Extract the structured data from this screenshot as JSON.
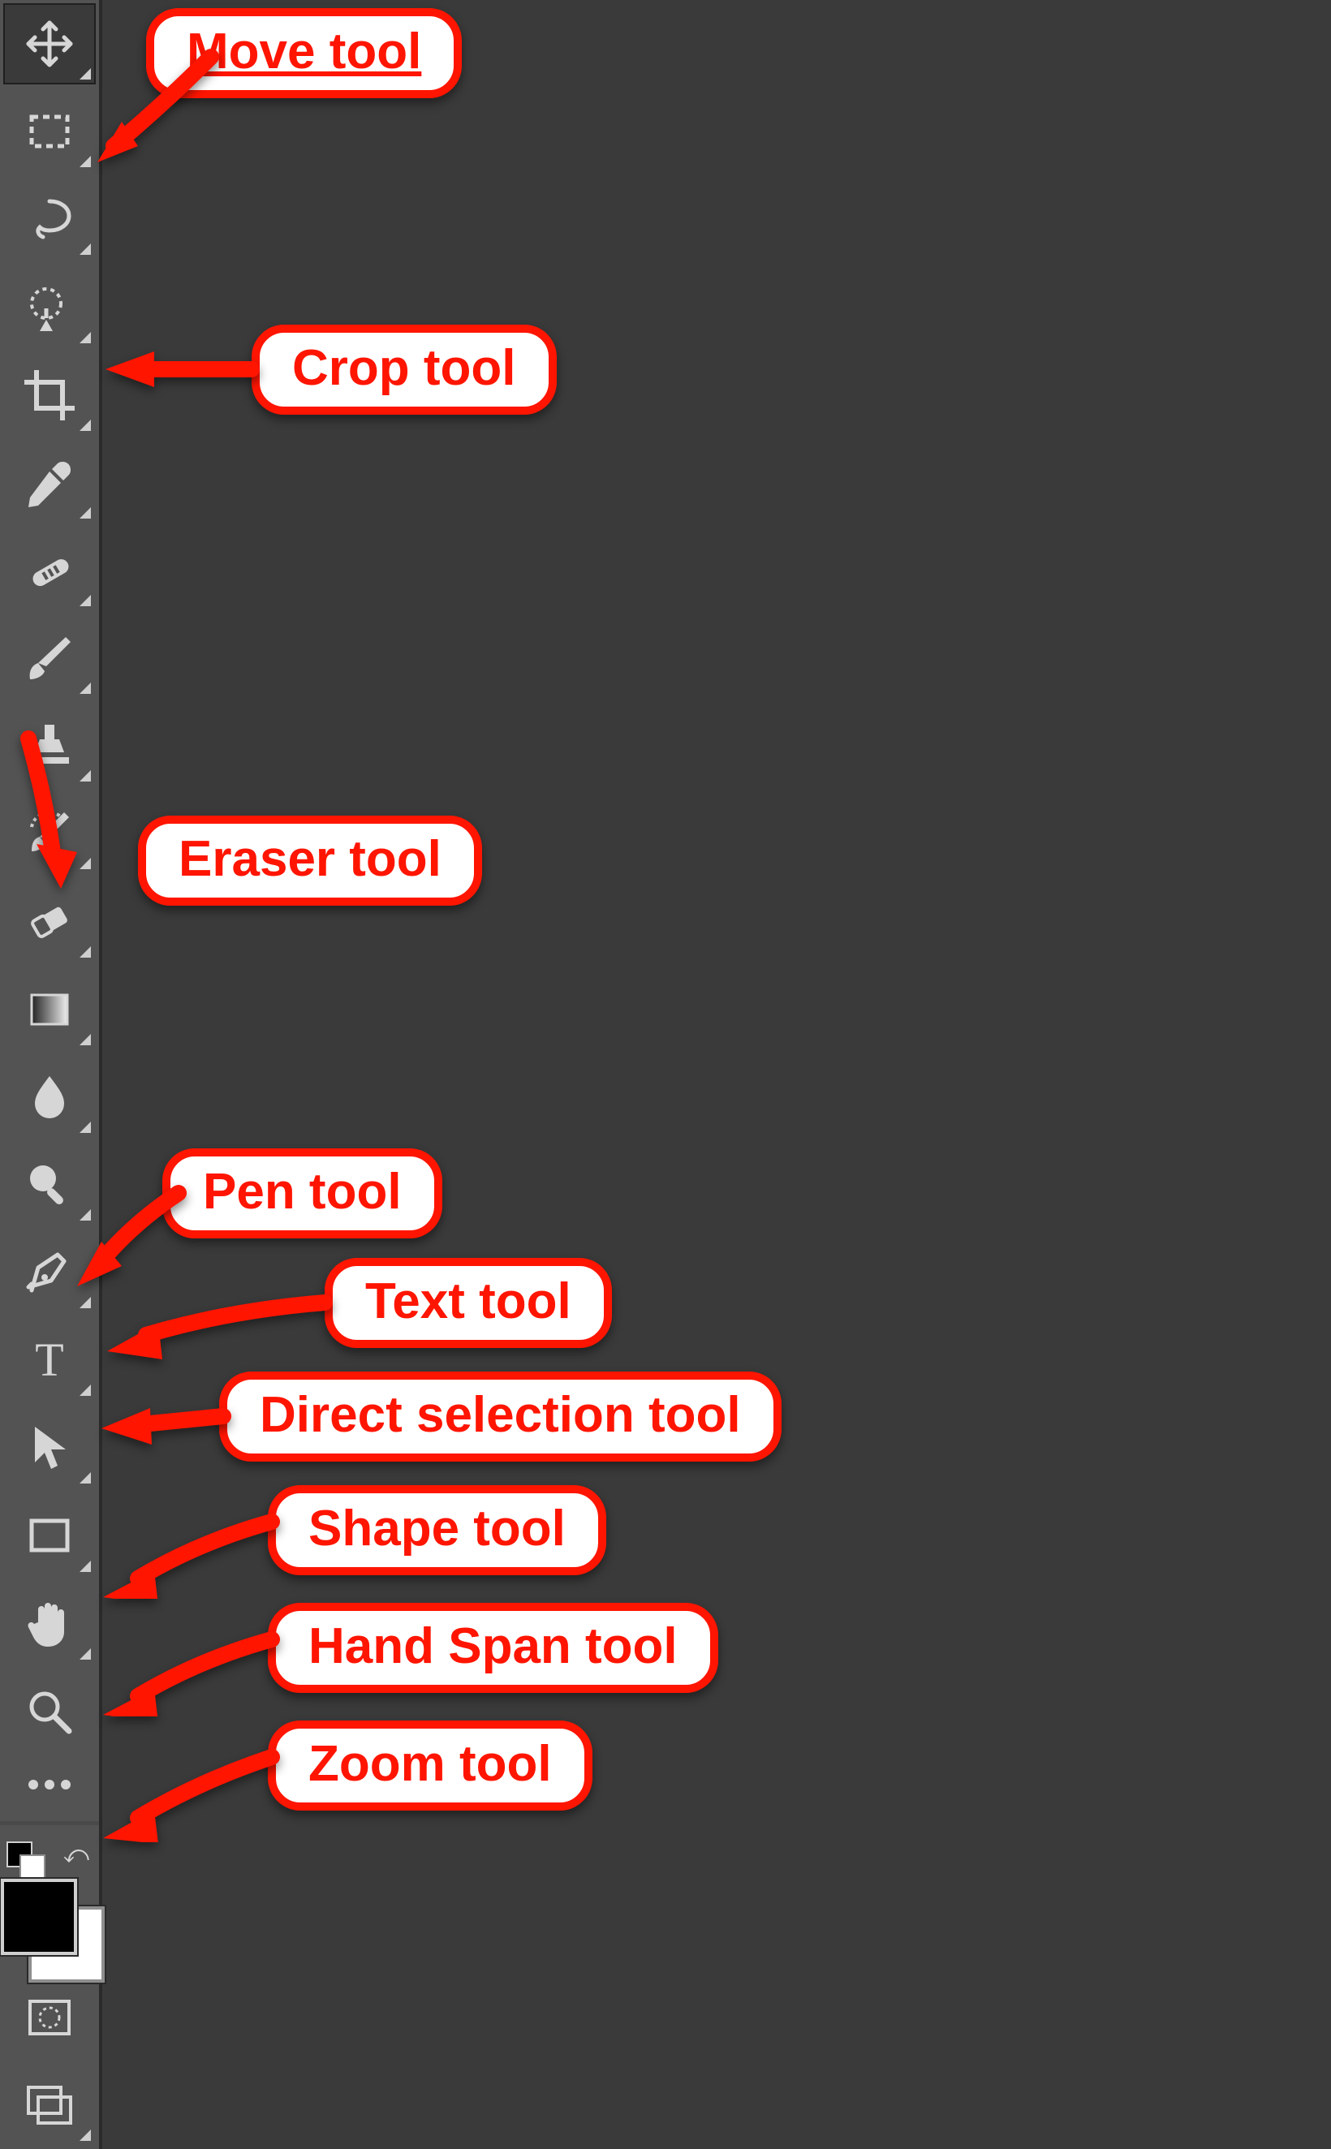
{
  "toolbar": {
    "tools": [
      {
        "id": "move",
        "name": "Move",
        "icon": "move-icon",
        "selected": true,
        "flyout": true
      },
      {
        "id": "marquee",
        "name": "Rectangular Marquee",
        "icon": "marquee-icon",
        "selected": false,
        "flyout": true
      },
      {
        "id": "lasso",
        "name": "Lasso",
        "icon": "lasso-icon",
        "selected": false,
        "flyout": true
      },
      {
        "id": "quick-select",
        "name": "Quick Selection",
        "icon": "quick-select-icon",
        "selected": false,
        "flyout": true
      },
      {
        "id": "crop",
        "name": "Crop",
        "icon": "crop-icon",
        "selected": false,
        "flyout": true
      },
      {
        "id": "eyedropper",
        "name": "Eyedropper",
        "icon": "eyedropper-icon",
        "selected": false,
        "flyout": true
      },
      {
        "id": "healing",
        "name": "Spot Healing Brush",
        "icon": "healing-icon",
        "selected": false,
        "flyout": true
      },
      {
        "id": "brush",
        "name": "Brush",
        "icon": "brush-icon",
        "selected": false,
        "flyout": true
      },
      {
        "id": "stamp",
        "name": "Clone Stamp",
        "icon": "stamp-icon",
        "selected": false,
        "flyout": true
      },
      {
        "id": "history-brush",
        "name": "History Brush",
        "icon": "history-brush-icon",
        "selected": false,
        "flyout": true
      },
      {
        "id": "eraser",
        "name": "Eraser",
        "icon": "eraser-icon",
        "selected": false,
        "flyout": true
      },
      {
        "id": "gradient",
        "name": "Gradient",
        "icon": "gradient-icon",
        "selected": false,
        "flyout": true
      },
      {
        "id": "blur",
        "name": "Blur",
        "icon": "blur-icon",
        "selected": false,
        "flyout": true
      },
      {
        "id": "dodge",
        "name": "Dodge",
        "icon": "dodge-icon",
        "selected": false,
        "flyout": true
      },
      {
        "id": "pen",
        "name": "Pen",
        "icon": "pen-icon",
        "selected": false,
        "flyout": true
      },
      {
        "id": "type",
        "name": "Horizontal Type",
        "icon": "type-icon",
        "selected": false,
        "flyout": true
      },
      {
        "id": "path-select",
        "name": "Path Selection",
        "icon": "path-select-icon",
        "selected": false,
        "flyout": true
      },
      {
        "id": "shape",
        "name": "Rectangle",
        "icon": "shape-icon",
        "selected": false,
        "flyout": true
      },
      {
        "id": "hand",
        "name": "Hand",
        "icon": "hand-icon",
        "selected": false,
        "flyout": true
      },
      {
        "id": "zoom",
        "name": "Zoom",
        "icon": "zoom-icon",
        "selected": false,
        "flyout": false
      },
      {
        "id": "edit-toolbar",
        "name": "Edit Toolbar",
        "icon": "ellipsis-icon",
        "selected": false,
        "flyout": false
      }
    ],
    "colors": {
      "foreground": "#000000",
      "background": "#ffffff"
    }
  },
  "annotations": [
    {
      "id": "move",
      "target": "move",
      "label": "Move tool",
      "underline": true
    },
    {
      "id": "crop",
      "target": "crop",
      "label": "Crop tool",
      "underline": false
    },
    {
      "id": "eraser",
      "target": "eraser",
      "label": "Eraser tool",
      "underline": false
    },
    {
      "id": "pen",
      "target": "pen",
      "label": "Pen tool",
      "underline": false
    },
    {
      "id": "text",
      "target": "type",
      "label": "Text tool",
      "underline": false
    },
    {
      "id": "direct-sel",
      "target": "path-select",
      "label": "Direct selection tool",
      "underline": false
    },
    {
      "id": "shape",
      "target": "shape",
      "label": "Shape tool",
      "underline": false
    },
    {
      "id": "hand",
      "target": "hand",
      "label": "Hand Span tool",
      "underline": false
    },
    {
      "id": "zoom",
      "target": "zoom",
      "label": "Zoom tool",
      "underline": false
    }
  ]
}
